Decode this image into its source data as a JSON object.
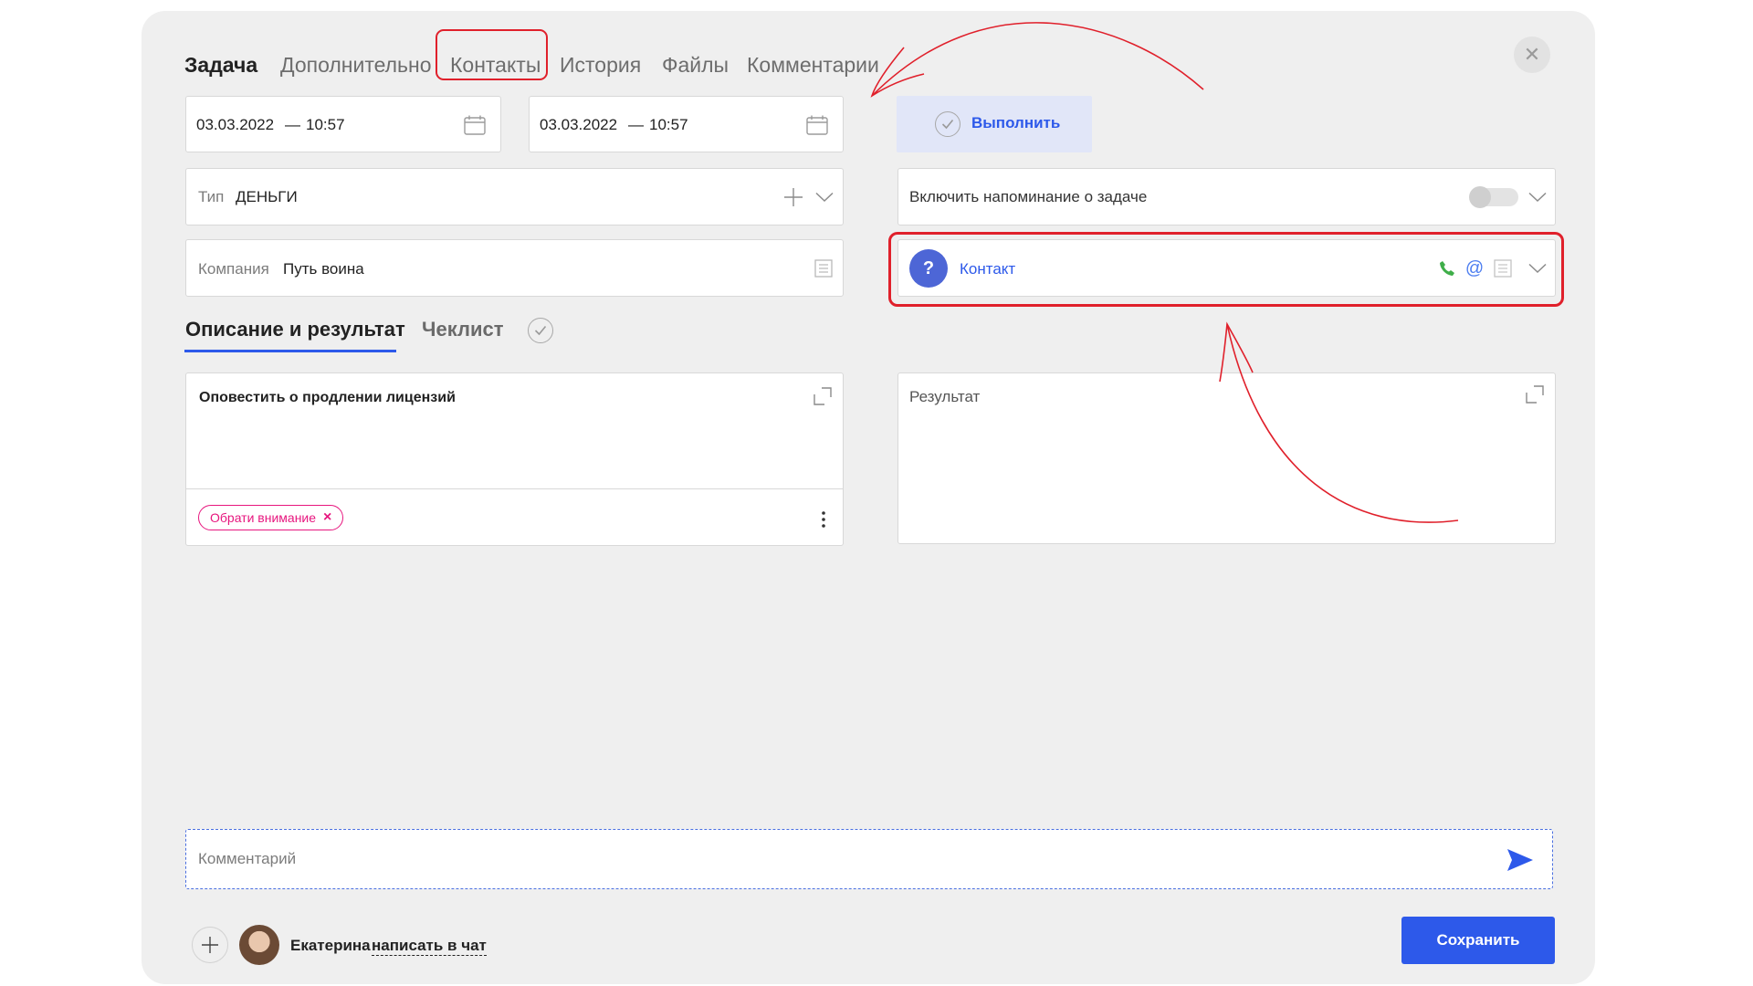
{
  "tabs": [
    {
      "label": "Задача",
      "active": true
    },
    {
      "label": "Дополнительно",
      "active": false
    },
    {
      "label": "Контакты",
      "active": false,
      "highlighted": true
    },
    {
      "label": "История",
      "active": false
    },
    {
      "label": "Файлы",
      "active": false
    },
    {
      "label": "Комментарии",
      "active": false
    }
  ],
  "close_label": "✕",
  "date_start": {
    "date": "03.03.2022",
    "separator": "—",
    "time": "10:57"
  },
  "date_end": {
    "date": "03.03.2022",
    "separator": "—",
    "time": "10:57"
  },
  "execute_button": {
    "label": "Выполнить"
  },
  "type_field": {
    "label": "Тип",
    "value": "ДЕНЬГИ"
  },
  "company_field": {
    "label": "Компания",
    "value": "Путь воина"
  },
  "reminder": {
    "label": "Включить напоминание о задаче",
    "enabled": false
  },
  "contact": {
    "avatar_symbol": "?",
    "label": "Контакт"
  },
  "subtabs": [
    {
      "label": "Описание и результат",
      "active": true
    },
    {
      "label": "Чеклист",
      "active": false
    }
  ],
  "description": {
    "text": "Оповестить о продлении лицензий"
  },
  "tag": {
    "label": "Обрати внимание",
    "remove_symbol": "×"
  },
  "result": {
    "placeholder": "Результат"
  },
  "comment": {
    "placeholder": "Комментарий"
  },
  "footer": {
    "user_name": "Екатерина",
    "chat_link": "написать в чат",
    "save_label": "Сохранить"
  },
  "colors": {
    "accent": "#2d59ea",
    "annotation": "#e0202b",
    "tag": "#e7167e",
    "phone": "#3fae49"
  },
  "icons": [
    "calendar-icon",
    "plus-icon",
    "chevron-down-icon",
    "document-icon",
    "phone-icon",
    "email-icon",
    "check-icon",
    "expand-icon",
    "kebab-menu-icon",
    "send-icon",
    "close-icon"
  ]
}
